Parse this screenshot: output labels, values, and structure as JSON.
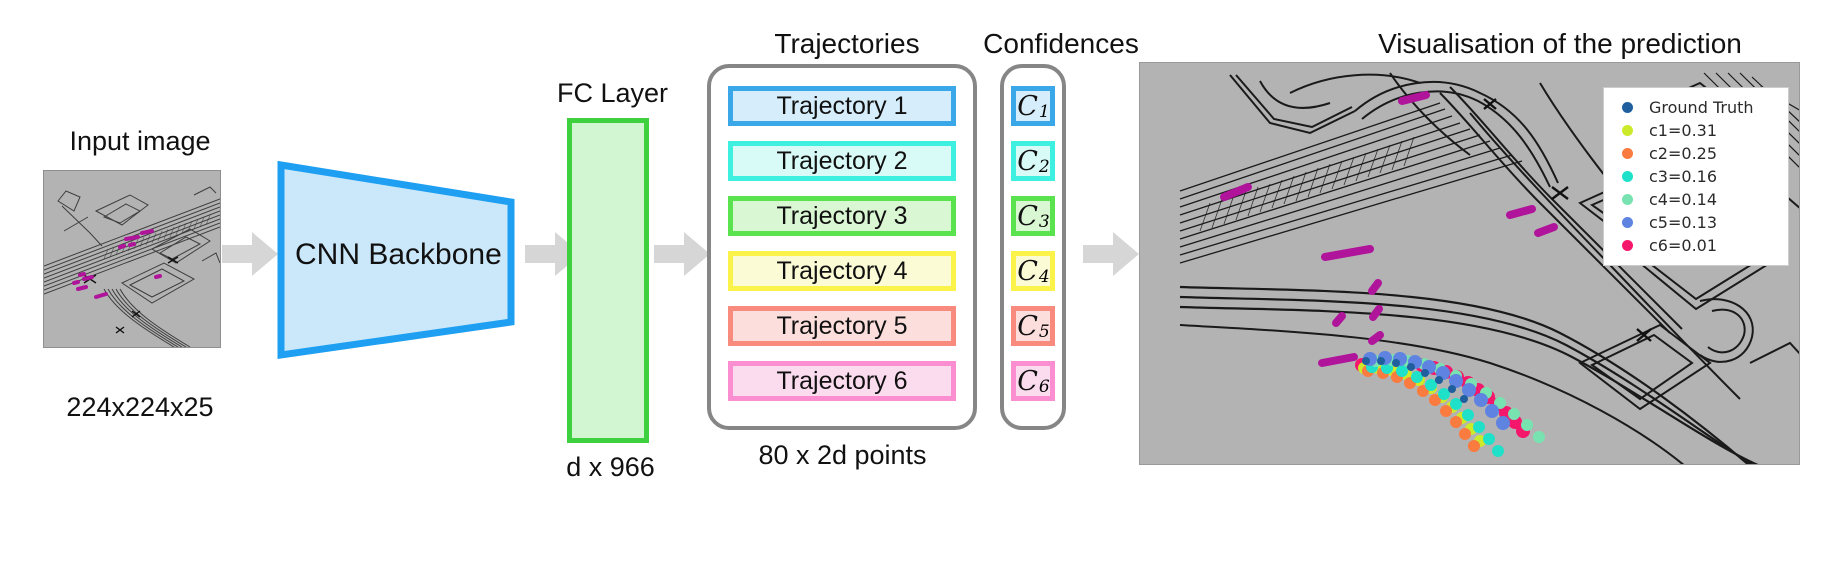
{
  "diagram": {
    "title_input": "Input image",
    "input_shape_label": "224x224x25",
    "cnn_label": "CNN Backbone",
    "fc_title": "FC Layer",
    "fc_shape_label": "d x 966",
    "trajectories_title": "Trajectories",
    "confidences_title": "Confidences",
    "points_label": "80 x 2d points",
    "visualisation_title": "Visualisation of the prediction"
  },
  "trajectories": [
    {
      "label": "Trajectory 1",
      "border": "#3aa8e8",
      "fill": "#d6eefb"
    },
    {
      "label": "Trajectory 2",
      "border": "#3df0e0",
      "fill": "#d8fbf7"
    },
    {
      "label": "Trajectory 3",
      "border": "#5ae24f",
      "fill": "#d8f7d2"
    },
    {
      "label": "Trajectory 4",
      "border": "#fbf24a",
      "fill": "#fbfbd6"
    },
    {
      "label": "Trajectory 5",
      "border": "#f98a7e",
      "fill": "#fcdfdd"
    },
    {
      "label": "Trajectory 6",
      "border": "#fb8ed0",
      "fill": "#fbdcee"
    }
  ],
  "confidences": [
    {
      "symbol": "C",
      "subscript": "1",
      "border": "#3aa8e8",
      "fill": "#d6eefb"
    },
    {
      "symbol": "C",
      "subscript": "2",
      "border": "#3df0e0",
      "fill": "#d8fbf7"
    },
    {
      "symbol": "C",
      "subscript": "3",
      "border": "#5ae24f",
      "fill": "#d8f7d2"
    },
    {
      "symbol": "C",
      "subscript": "4",
      "border": "#fbf24a",
      "fill": "#fbfbd6"
    },
    {
      "symbol": "C",
      "subscript": "5",
      "border": "#f98a7e",
      "fill": "#fcdfdd"
    },
    {
      "symbol": "C",
      "subscript": "6",
      "border": "#fb8ed0",
      "fill": "#fbdcee"
    }
  ],
  "legend": [
    {
      "label": "Ground Truth",
      "color": "#1f5f9e"
    },
    {
      "label": "c1=0.31",
      "color": "#cdea2a"
    },
    {
      "label": "c2=0.25",
      "color": "#fa7b40"
    },
    {
      "label": "c3=0.16",
      "color": "#1fe0c8"
    },
    {
      "label": "c4=0.14",
      "color": "#78e3b0"
    },
    {
      "label": "c5=0.13",
      "color": "#5f83e0"
    },
    {
      "label": "c6=0.01",
      "color": "#f5176b"
    }
  ],
  "colors": {
    "cnn_border": "#1e9ff2",
    "cnn_fill": "#cbe8fb",
    "fc_border": "#3fd040",
    "fc_fill": "#d2f5d2",
    "arrow": "#d6d6d6",
    "panel_border": "#868686",
    "map_background": "#b3b3b3",
    "map_lines": "#1a1a1a",
    "map_magenta": "#b0149b"
  },
  "icons": {
    "arrow": "right-arrow-icon",
    "legend_marker": "dot-marker-icon"
  }
}
